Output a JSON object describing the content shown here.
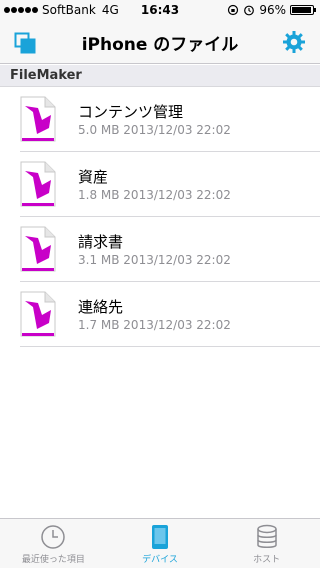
{
  "status_bar": {
    "carrier": "SoftBank",
    "network": "4G",
    "time": "16:43",
    "battery_percent_text": "96%",
    "battery_level": 0.96
  },
  "nav": {
    "title": "iPhone のファイル"
  },
  "section": {
    "title": "FileMaker"
  },
  "files": [
    {
      "name": "コンテンツ管理",
      "meta": "5.0 MB 2013/12/03 22:02"
    },
    {
      "name": "資産",
      "meta": "1.8 MB 2013/12/03 22:02"
    },
    {
      "name": "請求書",
      "meta": "3.1 MB 2013/12/03 22:02"
    },
    {
      "name": "連絡先",
      "meta": "1.7 MB 2013/12/03 22:02"
    }
  ],
  "tabs": [
    {
      "label": "最近使った項目",
      "icon": "clock-icon",
      "active": false
    },
    {
      "label": "デバイス",
      "icon": "device-icon",
      "active": true
    },
    {
      "label": "ホスト",
      "icon": "database-icon",
      "active": false
    }
  ],
  "colors": {
    "accent": "#1aa3d9",
    "file_icon": "#c800c8"
  }
}
